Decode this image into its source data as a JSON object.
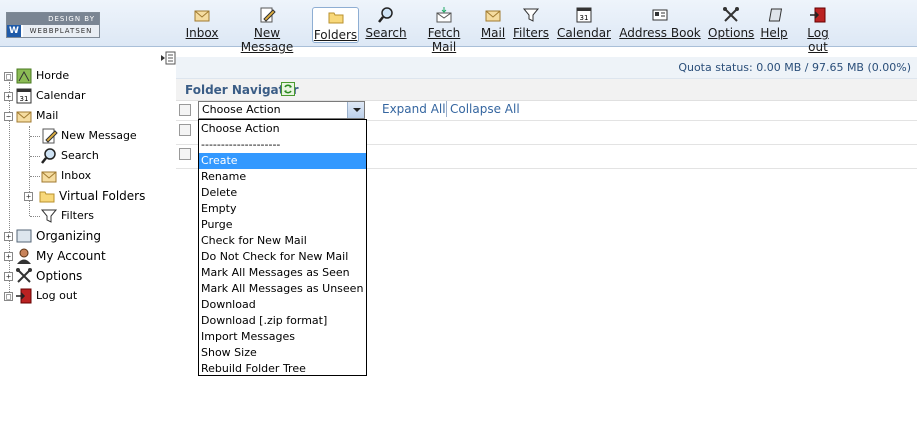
{
  "logo": {
    "top_text": "DESIGN BY",
    "letter": "W",
    "name": "WEBBPLATSEN"
  },
  "toolbar": {
    "items": [
      {
        "label": "Inbox",
        "icon": "inbox-icon",
        "selected": false
      },
      {
        "label": "New Message",
        "icon": "compose-icon",
        "selected": false
      },
      {
        "label": "Folders",
        "icon": "folder-icon",
        "selected": true
      },
      {
        "label": "Search",
        "icon": "search-icon",
        "selected": false
      },
      {
        "label": "Fetch Mail",
        "icon": "fetch-mail-icon",
        "selected": false
      },
      {
        "label": "Mail",
        "icon": "mail-icon",
        "selected": false
      },
      {
        "label": "Filters",
        "icon": "filter-icon",
        "selected": false
      },
      {
        "label": "Calendar",
        "icon": "calendar-icon",
        "selected": false
      },
      {
        "label": "Address Book",
        "icon": "address-book-icon",
        "selected": false
      },
      {
        "label": "Options",
        "icon": "options-icon",
        "selected": false
      },
      {
        "label": "Help",
        "icon": "help-book-icon",
        "selected": false
      },
      {
        "label": "Log out",
        "icon": "logout-icon",
        "selected": false
      }
    ]
  },
  "sidebar": {
    "tree": [
      {
        "label": "Horde",
        "icon": "horde-icon",
        "toggle": "□"
      },
      {
        "label": "Calendar",
        "icon": "calendar-icon",
        "toggle": "+"
      },
      {
        "label": "Mail",
        "icon": "mail-icon",
        "toggle": "−"
      },
      {
        "label": "New Message",
        "icon": "compose-icon"
      },
      {
        "label": "Search",
        "icon": "search-icon"
      },
      {
        "label": "Inbox",
        "icon": "inbox-icon"
      },
      {
        "label": "Virtual Folders",
        "icon": "folder-icon",
        "toggle": "+"
      },
      {
        "label": "Filters",
        "icon": "filter-icon"
      },
      {
        "label": "Organizing",
        "icon": "organizing-icon",
        "toggle": "+"
      },
      {
        "label": "My Account",
        "icon": "account-icon",
        "toggle": "+"
      },
      {
        "label": "Options",
        "icon": "options-icon",
        "toggle": "+"
      },
      {
        "label": "Log out",
        "icon": "logout-icon",
        "toggle": "□"
      }
    ]
  },
  "main": {
    "quota": "Quota status: 0.00 MB / 97.65 MB (0.00%)",
    "title": "Folder Navigator",
    "action_select_value": "Choose Action",
    "expand_all": "Expand All",
    "collapse_all": "Collapse All",
    "dropdown_options": [
      "Choose Action",
      "--------------------",
      "Create",
      "Rename",
      "Delete",
      "Empty",
      "Purge",
      "Check for New Mail",
      "Do Not Check for New Mail",
      "Mark All Messages as Seen",
      "Mark All Messages as Unseen",
      "Download",
      "Download [.zip format]",
      "Import Messages",
      "Show Size",
      "Rebuild Folder Tree"
    ],
    "dropdown_highlighted": "Create"
  },
  "colors": {
    "header_gradient_top": "#eef4fb",
    "link": "#3566a0",
    "title": "#3b5d86",
    "highlight": "#3399ff"
  }
}
